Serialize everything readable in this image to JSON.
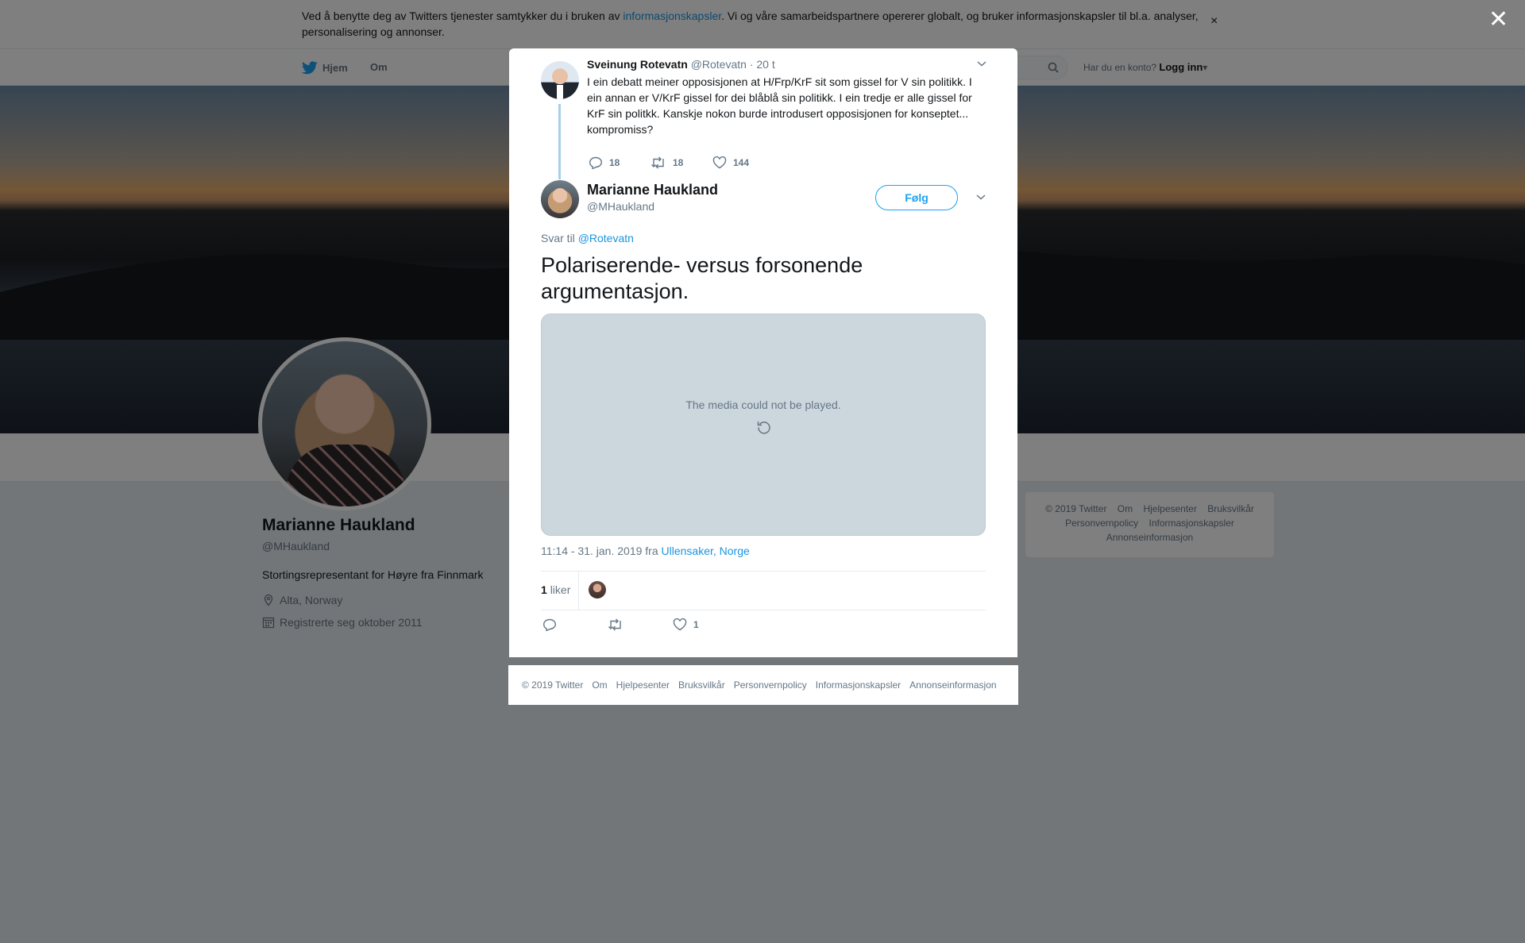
{
  "cookie": {
    "text_before": "Ved å benytte deg av Twitters tjenester samtykker du i bruken av ",
    "link": "informasjonskapsler",
    "text_after": ". Vi og våre samarbeidspartnere opererer globalt, og bruker informasjonskapsler til bl.a. analyser, personalisering og annonser.",
    "close": "×"
  },
  "nav": {
    "home": "Hjem",
    "about": "Om",
    "login_prompt": "Har du en konto?",
    "login": "Logg inn"
  },
  "overlay": {
    "close": "✕"
  },
  "profile": {
    "name": "Marianne Haukland",
    "handle": "@MHaukland",
    "bio": "Stortingsrepresentant for Høyre fra Finnmark",
    "location": "Alta, Norway",
    "joined": "Registrerte seg oktober 2011"
  },
  "right_footer": [
    "© 2019 Twitter",
    "Om",
    "Hjelpesenter",
    "Bruksvilkår",
    "Personvernpolicy",
    "Informasjonskapsler",
    "Annonseinformasjon"
  ],
  "parent_tweet": {
    "name": "Sveinung Rotevatn",
    "handle": "@Rotevatn",
    "time": "· 20 t",
    "text": "I ein debatt meiner opposisjonen at H/Frp/KrF sit som gissel for V sin politikk. I ein annan er V/KrF gissel for dei blåblå sin politikk. I ein tredje er alle gissel for KrF sin politkk. Kanskje nokon burde introdusert opposisjonen for konseptet... kompromiss?",
    "replies": "18",
    "retweets": "18",
    "likes": "144"
  },
  "tweet": {
    "name": "Marianne Haukland",
    "handle": "@MHaukland",
    "follow": "Følg",
    "reply_prefix": "Svar til",
    "reply_to": "@Rotevatn",
    "text": "Polariserende- versus forsonende argumentasjon.",
    "media_message": "The media could not be played.",
    "timestamp": "11:14 - 31. jan. 2019 fra",
    "location": "Ullensaker, Norge",
    "likes_count": "1",
    "likes_label": "liker",
    "action_likes": "1"
  },
  "modal_footer": [
    "© 2019 Twitter",
    "Om",
    "Hjelpesenter",
    "Bruksvilkår",
    "Personvernpolicy",
    "Informasjonskapsler",
    "Annonseinformasjon"
  ],
  "colors": {
    "accent": "#1da1f2",
    "link": "#1b95e0",
    "muted": "#657786"
  }
}
